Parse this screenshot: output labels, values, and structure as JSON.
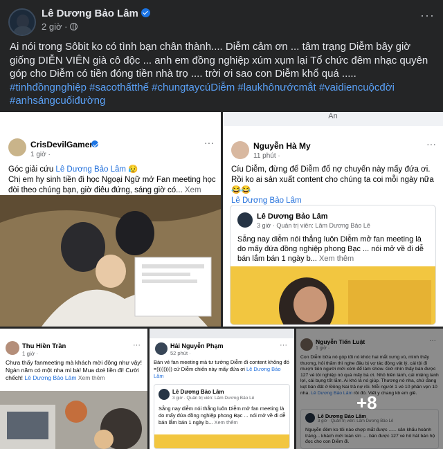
{
  "post": {
    "author": "Lê Dương Bảo Lâm",
    "time": "2 giờ ·",
    "more": "···",
    "text": "Ai nói trong Sôbit ko có tình bạn chân thành.... Diễm cảm ơn ... tâm trạng Diễm bây giờ giống DIỄN VIÊN già cô độc ... anh em đồng nghiệp xúm xụm lại Tổ chức đêm nhạc quyên góp cho Diễm có tiền đóng tiền nhà trọ .... trời ơi sao con Diễm khổ quá .....",
    "hashtags": "#tinhđồngnghiệp #sacothấtthế #chungtaycúDiễm #laukhônướcmắt #vaidiencuộcđời #anhsángcuốiđường"
  },
  "photos": {
    "p1": {
      "name": "CrisDevilGamer",
      "time": "1 giờ · ",
      "text_a": "Góc giải cứu ",
      "mention": "Lê Dương Bảo Lâm",
      "text_b": " 😥",
      "text_c": "Chị em hy sinh tiền đi học Ngoại Ngữ mở Fan meeting học đòi theo chúng bạn, giờ điêu đứng, sáng giờ có... ",
      "see_more": "Xem thêm",
      "dots": "···"
    },
    "p2": {
      "top_label": "An",
      "name": "Nguyễn Hà My",
      "time": "11 phút · ",
      "text": "Cíu Diễm, đừng để Diễm đổ nợ chuyến này mấy đứa ơi. Rồi ko ai sản xuất content cho chúng ta coi mỗi ngày nữa 😂😂",
      "mention": "Lê Dương Bảo Lâm",
      "shared_name": "Lê Dương Bảo Lâm",
      "shared_meta": "3 giờ · Quản trị viên: Lâm Dương Bảo Lê",
      "shared_text": "Sẵng nay diễm nói thẳng luôn Diễm mở fan meeting  là do mấy đứa đồng nghiệp phong Bạc ... nói mở về đi dễ bán lắm bán 1 ngày b... ",
      "see_more": "Xem thêm",
      "dots": "···"
    },
    "p3": {
      "name": "Thu Hiền Trần",
      "time": "1 giờ · ",
      "text": "Chưa thấy fanmeeting mà khách mời đông như vậy! Ngàn năm có một nha mi bà! Mua dzé liền đi! Cười chếch! ",
      "mention": "Lê Dương Bảo Lâm",
      "see_more": "Xem thêm",
      "dots": "···"
    },
    "p4": {
      "name": "Hải Nguyễn Phạm",
      "time": "52 phút · ",
      "text": "Bán vé fan meeting mà tư tưởng Diễm đi content không đó =))))))))) cứ Diễm chiến này mấy đứa ơi ",
      "mention": "Lê Dương Bảo Lâm",
      "shared_name": "Lê Dương Bảo Lâm",
      "shared_meta": "3 giờ · Quản trị viên: Lâm Dương Bảo Lê",
      "shared_text": "Sẵng nay diễm nói thẳng luôn Diễm mở fan meeting  là do mấy đứa đồng nghiệp phong Bạc ... nói mở về đi dễ bán lắm bán 1 ngày b... ",
      "see_more": "Xem thêm",
      "dots": "···"
    },
    "p5": {
      "name": "Nguyễn Tiến Luật",
      "time": "1 giờ · ",
      "text": "Con Diễm bữa nó góp tối nó khóc hai mắt xưng vù, mình thấy thương, hỏi thăm thì nghe đâu bị vợ tác động vật lý, cái tội đi mượn tiền người mời xóm để làm show. Giờ nhìn thấy bán được 127 vé tôi nghiệp nó quá mấy bà ơi. Nhỏ hiền lành, cái miệng lanh lợi, cái bụng tốt lắm. Ai khó là nó giúp. Thương nó nha, chứ đang kẹt bán đất ở Đồng Nai trả nợ rồi. Mỗi người 1 vé 10 phần vẹn 10 nha. ",
      "mention": "Lê Dương Bảo Lâm",
      "text_b": " rồi đó. Viết y chang kb em giề.",
      "shared_name": "Lê Dương Bảo Lâm",
      "shared_meta": "3 giờ · Quản trị viên: Lâm Dương Bảo Lê",
      "shared_text": "Nguyễn đêm ko tôi nào chợp mắt được ...... sân khấu hoành tráng... khách mời toàn sìn .... bán được 127 vé hô hát bán hộ đọc cho con Diễm đi. ",
      "dots": "···",
      "more_count": "+8"
    }
  },
  "colors": {
    "background": "#242526",
    "text": "#e4e6eb",
    "muted": "#b0b3b8",
    "hashtag": "#5aa0f5",
    "verified": "#1b74e4",
    "link": "#216fdb"
  },
  "icons": [
    "verified-badge-icon",
    "globe-icon",
    "more-options-icon"
  ]
}
